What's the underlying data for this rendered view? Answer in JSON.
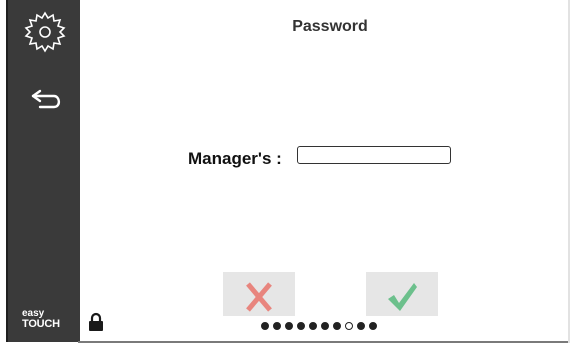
{
  "header": {
    "title": "Password"
  },
  "form": {
    "label": "Manager's :",
    "value": "",
    "placeholder": ""
  },
  "sidebar": {
    "settings_icon": "gear-icon",
    "back_icon": "back-arrow-icon",
    "brand_line1": "easy",
    "brand_line2": "TOUCH"
  },
  "actions": {
    "cancel_icon": "cross-icon",
    "confirm_icon": "check-icon",
    "cancel_color": "#e8857e",
    "confirm_color": "#6cc08c"
  },
  "status": {
    "lock_icon": "lock-icon"
  },
  "pagination": {
    "total": 10,
    "current": 8
  }
}
